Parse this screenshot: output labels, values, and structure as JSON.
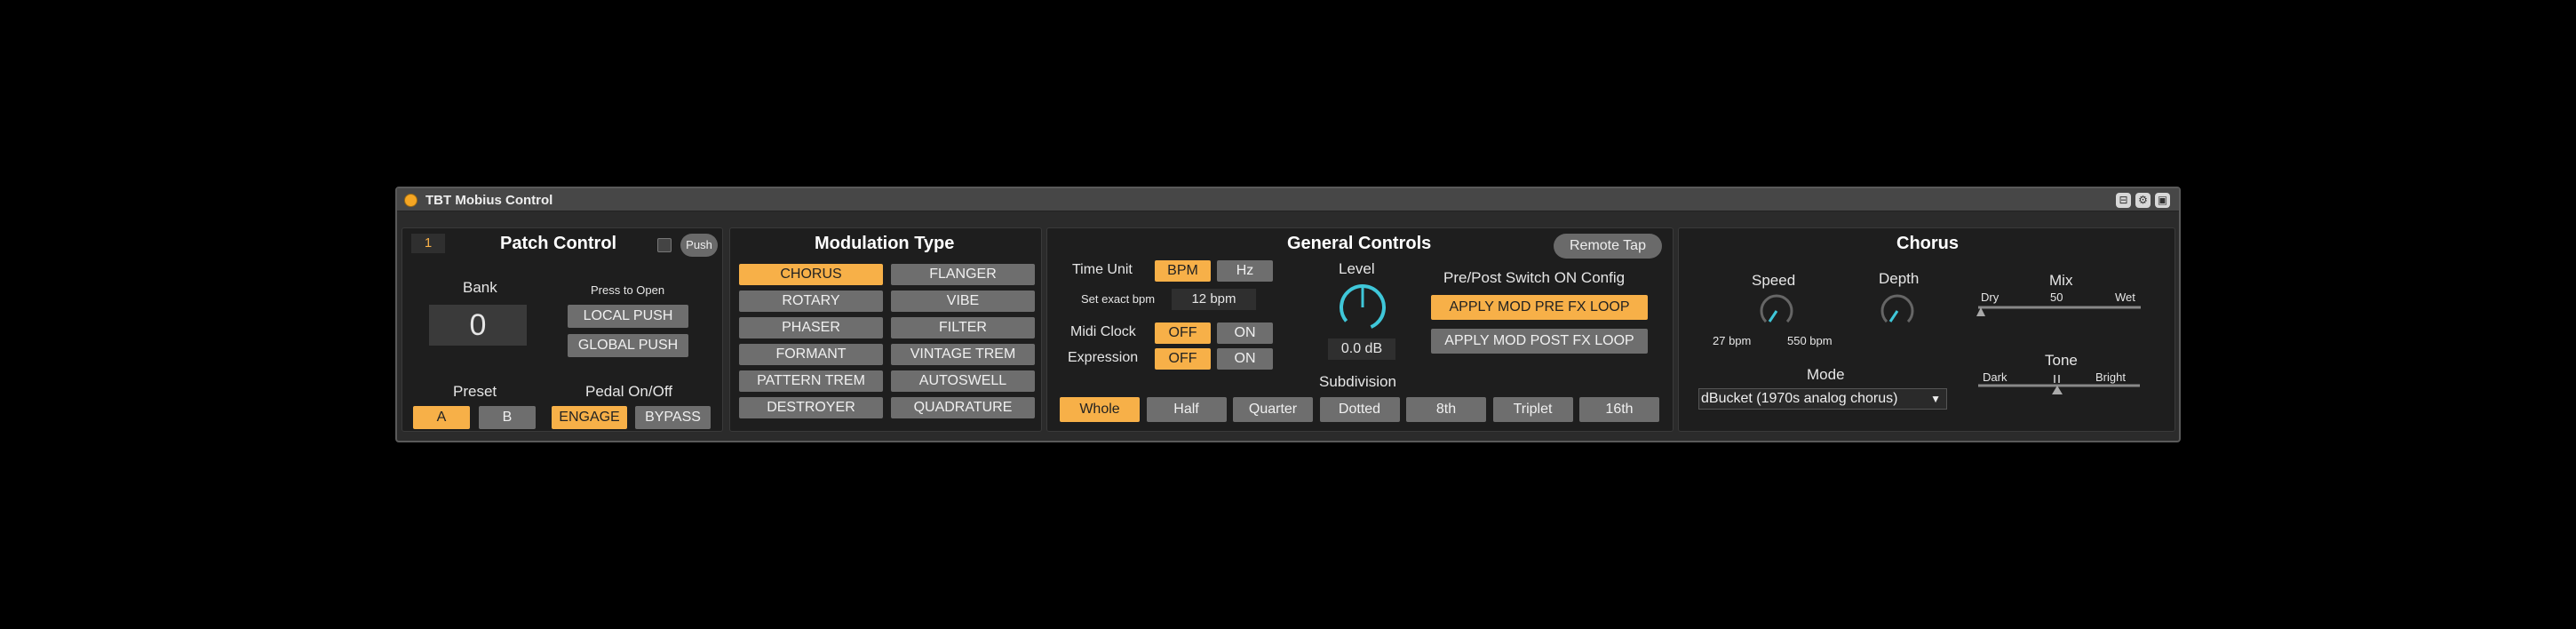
{
  "device": {
    "title": "TBT Mobius Control",
    "window_icons": [
      "window-icon",
      "settings-icon",
      "save-icon"
    ]
  },
  "patch": {
    "title": "Patch Control",
    "number": "1",
    "push_label": "Push",
    "bank_label": "Bank",
    "bank_value": "0",
    "press_to_open": "Press to Open",
    "local_push": "LOCAL PUSH",
    "global_push": "GLOBAL PUSH",
    "preset_label": "Preset",
    "preset_a": "A",
    "preset_b": "B",
    "pedal_label": "Pedal On/Off",
    "engage": "ENGAGE",
    "bypass": "BYPASS"
  },
  "modulation": {
    "title": "Modulation Type",
    "types": [
      "CHORUS",
      "FLANGER",
      "ROTARY",
      "VIBE",
      "PHASER",
      "FILTER",
      "FORMANT",
      "VINTAGE TREM",
      "PATTERN TREM",
      "AUTOSWELL",
      "DESTROYER",
      "QUADRATURE"
    ],
    "selected": "CHORUS"
  },
  "general": {
    "title": "General Controls",
    "remote_tap": "Remote Tap",
    "time_unit_label": "Time Unit",
    "bpm": "BPM",
    "hz": "Hz",
    "exact_bpm_label": "Set exact bpm",
    "exact_bpm_value": "12 bpm",
    "midi_clock_label": "Midi Clock",
    "expression_label": "Expression",
    "off": "OFF",
    "on": "ON",
    "level_label": "Level",
    "level_value": "0.0 dB",
    "prepost_label": "Pre/Post Switch ON Config",
    "apply_pre": "APPLY MOD PRE FX LOOP",
    "apply_post": "APPLY MOD POST FX LOOP",
    "subdivision_label": "Subdivision",
    "subdivisions": [
      "Whole",
      "Half",
      "Quarter",
      "Dotted",
      "8th",
      "Triplet",
      "16th"
    ],
    "selected_subdivision": "Whole"
  },
  "chorus": {
    "title": "Chorus",
    "speed_label": "Speed",
    "speed_min": "27 bpm",
    "speed_max": "550 bpm",
    "depth_label": "Depth",
    "mix_label": "Mix",
    "mix_dry": "Dry",
    "mix_value": "50",
    "mix_wet": "Wet",
    "tone_label": "Tone",
    "tone_dark": "Dark",
    "tone_bright": "Bright",
    "mode_label": "Mode",
    "mode_value": "dBucket (1970s analog chorus)"
  },
  "colors": {
    "accent": "#f7b048",
    "button": "#6e6e6e",
    "knob_indicator": "#3fc7d9"
  }
}
